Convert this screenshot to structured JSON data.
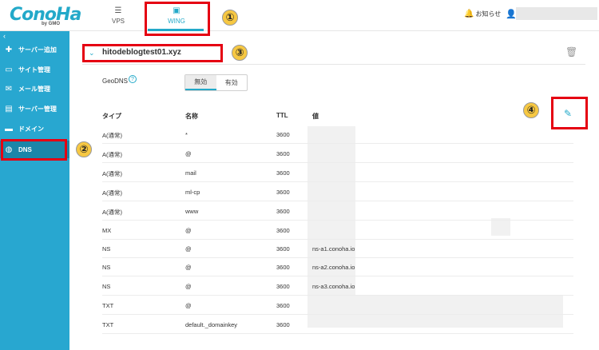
{
  "header": {
    "logo_text": "ConoHa",
    "logo_sub": "by GMO",
    "tabs": [
      {
        "label": "VPS",
        "icon": "server-icon"
      },
      {
        "label": "WING",
        "icon": "wing-icon"
      }
    ],
    "notifications_label": "お知らせ"
  },
  "sidebar": {
    "items": [
      {
        "label": "サーバー追加",
        "icon": "plus-icon"
      },
      {
        "label": "サイト管理",
        "icon": "site-icon"
      },
      {
        "label": "メール管理",
        "icon": "mail-icon"
      },
      {
        "label": "サーバー管理",
        "icon": "server-manage-icon"
      },
      {
        "label": "ドメイン",
        "icon": "domain-icon"
      },
      {
        "label": "DNS",
        "icon": "globe-icon"
      }
    ]
  },
  "dns": {
    "domain": "hitodeblogtest01.xyz",
    "geodns_label": "GeoDNS",
    "geodns_options": [
      "無効",
      "有効"
    ],
    "geodns_selected": "無効",
    "columns": [
      "タイプ",
      "名称",
      "TTL",
      "値"
    ],
    "records": [
      {
        "type": "A(通常)",
        "name": "*",
        "ttl": "3600",
        "value": ""
      },
      {
        "type": "A(通常)",
        "name": "@",
        "ttl": "3600",
        "value": ""
      },
      {
        "type": "A(通常)",
        "name": "mail",
        "ttl": "3600",
        "value": ""
      },
      {
        "type": "A(通常)",
        "name": "ml-cp",
        "ttl": "3600",
        "value": ""
      },
      {
        "type": "A(通常)",
        "name": "www",
        "ttl": "3600",
        "value": ""
      },
      {
        "type": "MX",
        "name": "@",
        "ttl": "3600",
        "value": ""
      },
      {
        "type": "NS",
        "name": "@",
        "ttl": "3600",
        "value": "ns-a1.conoha.io"
      },
      {
        "type": "NS",
        "name": "@",
        "ttl": "3600",
        "value": "ns-a2.conoha.io"
      },
      {
        "type": "NS",
        "name": "@",
        "ttl": "3600",
        "value": "ns-a3.conoha.io"
      },
      {
        "type": "TXT",
        "name": "@",
        "ttl": "3600",
        "value": ""
      },
      {
        "type": "TXT",
        "name": "default._domainkey",
        "ttl": "3600",
        "value": ""
      }
    ]
  },
  "annotations": {
    "step1": "①",
    "step2": "②",
    "step3": "③",
    "step4": "④",
    "highlight_color": "#e50012"
  },
  "colors": {
    "accent": "#23a9c9",
    "sidebar": "#28a7d0",
    "sidebar_active": "#1b86a8"
  }
}
